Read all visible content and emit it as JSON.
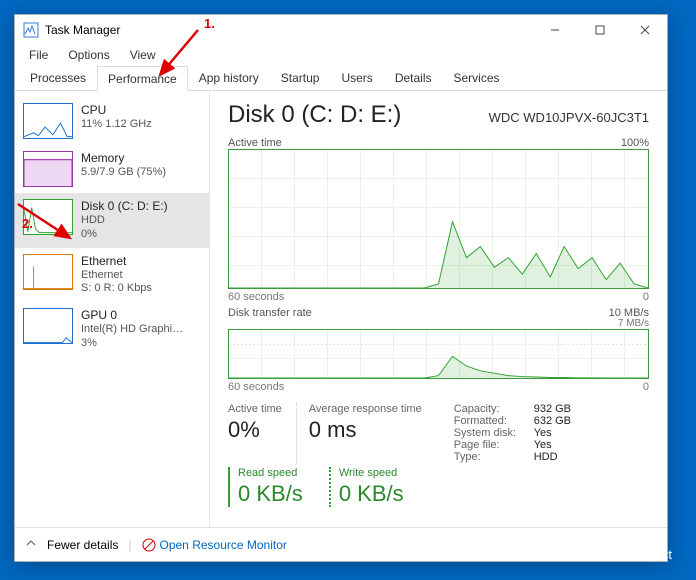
{
  "window": {
    "title": "Task Manager"
  },
  "menu": {
    "file": "File",
    "options": "Options",
    "view": "View"
  },
  "tabs": {
    "processes": "Processes",
    "performance": "Performance",
    "app_history": "App history",
    "startup": "Startup",
    "users": "Users",
    "details": "Details",
    "services": "Services"
  },
  "sidebar": {
    "items": [
      {
        "title": "CPU",
        "line2": "11%  1.12 GHz"
      },
      {
        "title": "Memory",
        "line2": "5.9/7.9 GB (75%)"
      },
      {
        "title": "Disk 0 (C: D: E:)",
        "line2": "HDD",
        "line3": "0%"
      },
      {
        "title": "Ethernet",
        "line2": "Ethernet",
        "line3": "S: 0 R: 0 Kbps"
      },
      {
        "title": "GPU 0",
        "line2": "Intel(R) HD Graphi…",
        "line3": "3%"
      }
    ]
  },
  "detail": {
    "title": "Disk 0 (C: D: E:)",
    "model": "WDC WD10JPVX-60JC3T1",
    "chart1": {
      "label": "Active time",
      "max": "100%",
      "x_left": "60 seconds",
      "x_right": "0"
    },
    "chart2": {
      "label": "Disk transfer rate",
      "max": "10 MB/s",
      "inner_max": "7 MB/s",
      "x_left": "60 seconds",
      "x_right": "0"
    },
    "stats": {
      "active_time": {
        "label": "Active time",
        "value": "0%"
      },
      "avg_response": {
        "label": "Average response time",
        "value": "0 ms"
      },
      "read_speed": {
        "label": "Read speed",
        "value": "0 KB/s"
      },
      "write_speed": {
        "label": "Write speed",
        "value": "0 KB/s"
      }
    },
    "info": {
      "capacity": {
        "k": "Capacity:",
        "v": "932 GB"
      },
      "formatted": {
        "k": "Formatted:",
        "v": "632 GB"
      },
      "system_disk": {
        "k": "System disk:",
        "v": "Yes"
      },
      "page_file": {
        "k": "Page file:",
        "v": "Yes"
      },
      "type": {
        "k": "Type:",
        "v": "HDD"
      }
    }
  },
  "footer": {
    "fewer": "Fewer details",
    "resmon": "Open Resource Monitor"
  },
  "annotations": {
    "one": "1.",
    "two": "2."
  },
  "watermark": "©Howtoconnect",
  "chart_data": [
    {
      "type": "line",
      "title": "Active time",
      "ylabel": "% active time",
      "ylim": [
        0,
        100
      ],
      "x": [
        60,
        58,
        56,
        54,
        52,
        50,
        48,
        46,
        44,
        42,
        40,
        38,
        36,
        34,
        32,
        30,
        28,
        26,
        24,
        22,
        20,
        18,
        16,
        14,
        12,
        10,
        8,
        6,
        4,
        2,
        0
      ],
      "values": [
        0,
        0,
        0,
        0,
        0,
        0,
        0,
        0,
        0,
        0,
        0,
        0,
        0,
        0,
        0,
        3,
        48,
        22,
        30,
        15,
        22,
        10,
        25,
        8,
        30,
        14,
        22,
        6,
        18,
        3,
        0
      ]
    },
    {
      "type": "line",
      "title": "Disk transfer rate",
      "ylabel": "MB/s",
      "ylim": [
        0,
        10
      ],
      "x": [
        60,
        58,
        56,
        54,
        52,
        50,
        48,
        46,
        44,
        42,
        40,
        38,
        36,
        34,
        32,
        30,
        28,
        26,
        24,
        22,
        20,
        18,
        16,
        14,
        12,
        10,
        8,
        6,
        4,
        2,
        0
      ],
      "series": [
        {
          "name": "Read",
          "values": [
            0,
            0,
            0,
            0,
            0,
            0,
            0,
            0,
            0,
            0,
            0,
            0,
            0,
            0,
            0,
            0.5,
            4.5,
            2.5,
            1.5,
            1,
            0.5,
            0.3,
            0.2,
            0.1,
            0.1,
            0.05,
            0.05,
            0,
            0,
            0,
            0
          ]
        },
        {
          "name": "Write",
          "values": [
            0,
            0,
            0,
            0,
            0,
            0,
            0,
            0,
            0,
            0,
            0,
            0,
            0,
            0,
            0,
            0,
            0,
            0,
            0,
            0,
            0,
            0,
            0,
            0,
            0,
            0,
            0,
            0,
            0,
            0,
            0
          ]
        }
      ]
    }
  ]
}
